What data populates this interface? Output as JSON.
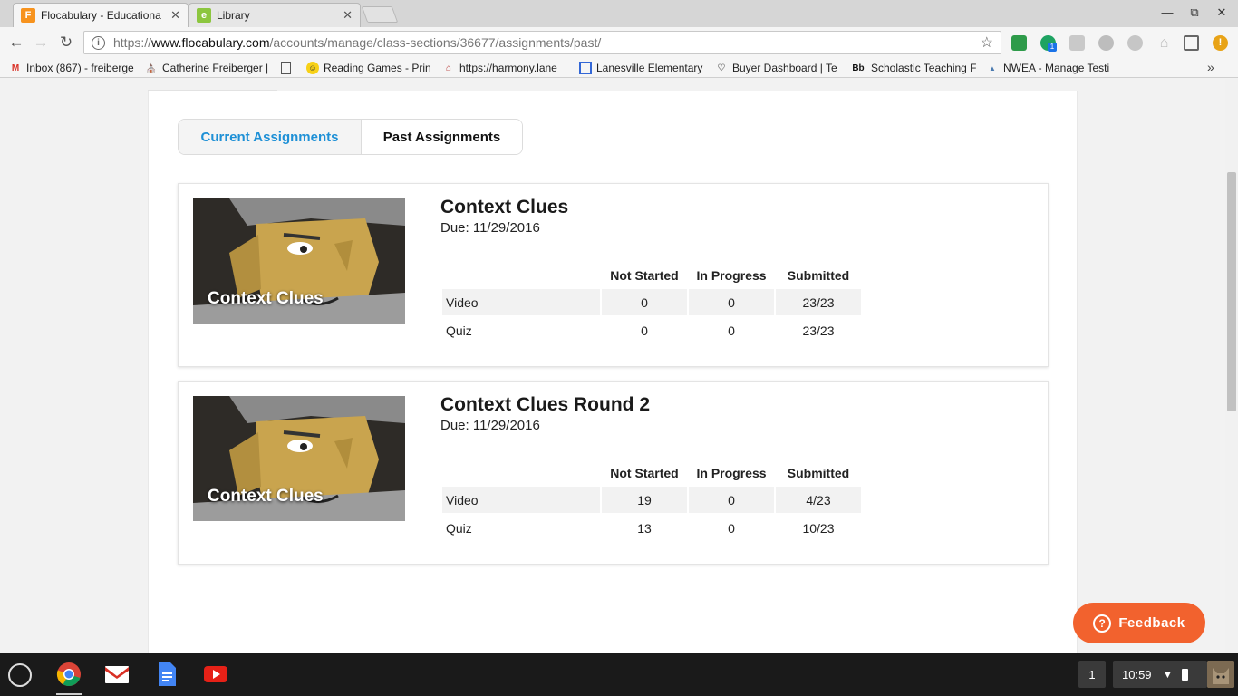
{
  "browser": {
    "tabs": [
      {
        "label": "Flocabulary - Educationa",
        "favicon": "F",
        "favicon_color": "#f7931e",
        "active": true
      },
      {
        "label": "Library",
        "favicon": "e",
        "favicon_color": "#8cc63f",
        "active": false
      }
    ],
    "tab_close": "✕",
    "window_controls": {
      "minimize": "—",
      "restore": "⧉",
      "close": "✕"
    },
    "url": {
      "scheme": "https://",
      "host": "www.flocabulary.com",
      "path": "/accounts/manage/class-sections/36677/assignments/past/"
    },
    "bookmarks": [
      {
        "label": "Inbox (867) - freiberge",
        "icon": "gmail-icon"
      },
      {
        "label": "Catherine Freiberger |",
        "icon": "school-icon"
      },
      {
        "label": "",
        "icon": "page-icon"
      },
      {
        "label": "Reading Games - Prin",
        "icon": "smiley-icon"
      },
      {
        "label": "https://harmony.lane",
        "icon": "house-icon"
      },
      {
        "label": "Lanesville Elementary",
        "icon": "calendar-icon"
      },
      {
        "label": "Buyer Dashboard | Te",
        "icon": "tpt-icon"
      },
      {
        "label": "Scholastic Teaching F",
        "icon": "bb-icon"
      },
      {
        "label": "NWEA - Manage Testi",
        "icon": "nwea-icon"
      }
    ],
    "bookmarks_more": "»",
    "extension_badge": "1"
  },
  "page": {
    "tabs": {
      "current": "Current Assignments",
      "past": "Past Assignments"
    },
    "accent_color": "#1e90d6",
    "assignments": [
      {
        "title": "Context Clues",
        "due": "Due: 11/29/2016",
        "thumbnail_label": "Context Clues",
        "headers": [
          "Not Started",
          "In Progress",
          "Submitted"
        ],
        "rows": [
          {
            "label": "Video",
            "not_started": "0",
            "in_progress": "0",
            "submitted": "23/23"
          },
          {
            "label": "Quiz",
            "not_started": "0",
            "in_progress": "0",
            "submitted": "23/23"
          }
        ]
      },
      {
        "title": "Context Clues Round 2",
        "due": "Due: 11/29/2016",
        "thumbnail_label": "Context Clues",
        "headers": [
          "Not Started",
          "In Progress",
          "Submitted"
        ],
        "rows": [
          {
            "label": "Video",
            "not_started": "19",
            "in_progress": "0",
            "submitted": "4/23"
          },
          {
            "label": "Quiz",
            "not_started": "13",
            "in_progress": "0",
            "submitted": "10/23"
          }
        ]
      }
    ],
    "feedback_label": "Feedback",
    "feedback_color": "#f2622e"
  },
  "shelf": {
    "window_count": "1",
    "time": "10:59"
  }
}
